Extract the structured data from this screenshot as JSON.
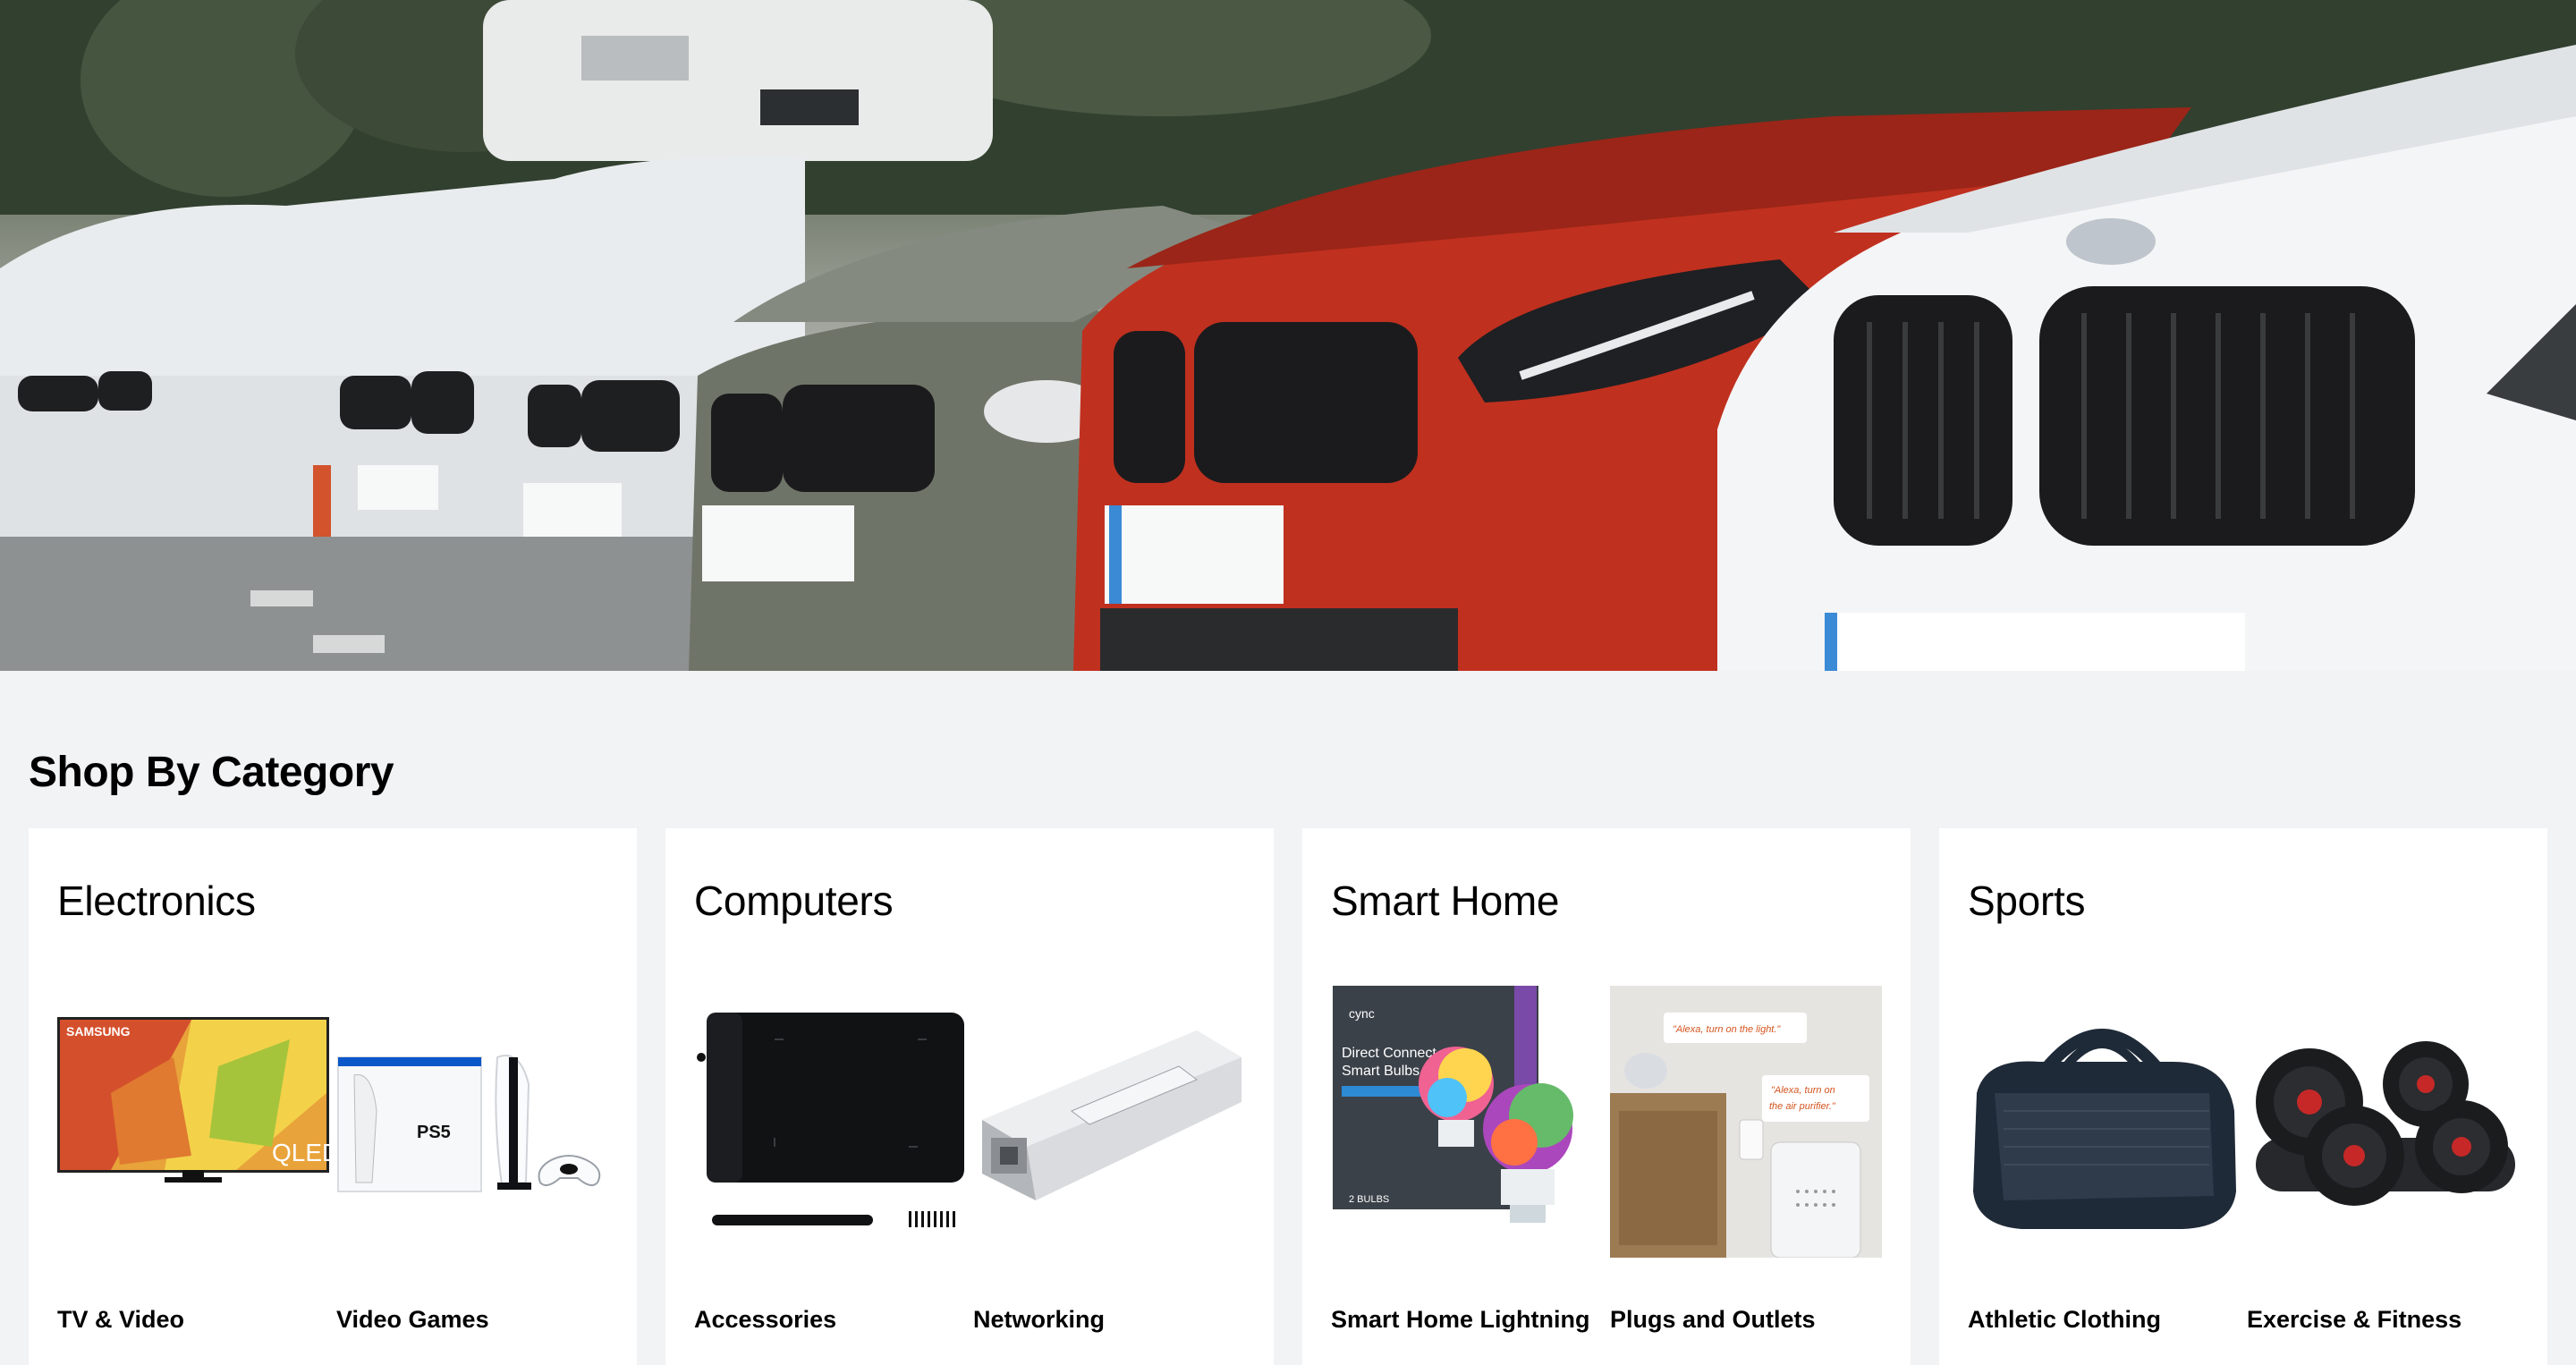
{
  "hero": {
    "image": "row-of-parked-cars-photo",
    "colors": {
      "red_car": "#c0301f",
      "white_car": "#f4f5f6",
      "grey_car": "#6f7468",
      "grille": "#1b1b1d"
    }
  },
  "section": {
    "title": "Shop By Category"
  },
  "categories": [
    {
      "title": "Electronics",
      "items": [
        {
          "label": "TV & Video",
          "image": "qled-tv"
        },
        {
          "label": "Video Games",
          "image": "ps5-console"
        }
      ]
    },
    {
      "title": "Computers",
      "items": [
        {
          "label": "Accessories",
          "image": "drawing-tablet"
        },
        {
          "label": "Networking",
          "image": "sfp-module"
        }
      ]
    },
    {
      "title": "Smart Home",
      "items": [
        {
          "label": "Smart Home Lightning",
          "image": "smart-bulbs"
        },
        {
          "label": "Plugs and Outlets",
          "image": "smart-plug"
        }
      ]
    },
    {
      "title": "Sports",
      "items": [
        {
          "label": "Athletic Clothing",
          "image": "gym-bag"
        },
        {
          "label": "Exercise & Fitness",
          "image": "dumbbells"
        }
      ]
    }
  ],
  "product_text": {
    "tv_brand": "SAMSUNG",
    "tv_badge": "QLED",
    "ps5_logo": "PS5",
    "bulb_brand": "cync",
    "bulb_box_line1": "Direct Connect",
    "bulb_box_line2": "Smart Bulbs",
    "bulb_box_count": "2 BULBS",
    "alexa_quote_1": "\"Alexa, turn on the light.\"",
    "alexa_quote_2a": "\"Alexa, turn on",
    "alexa_quote_2b": "the air purifier.\""
  }
}
